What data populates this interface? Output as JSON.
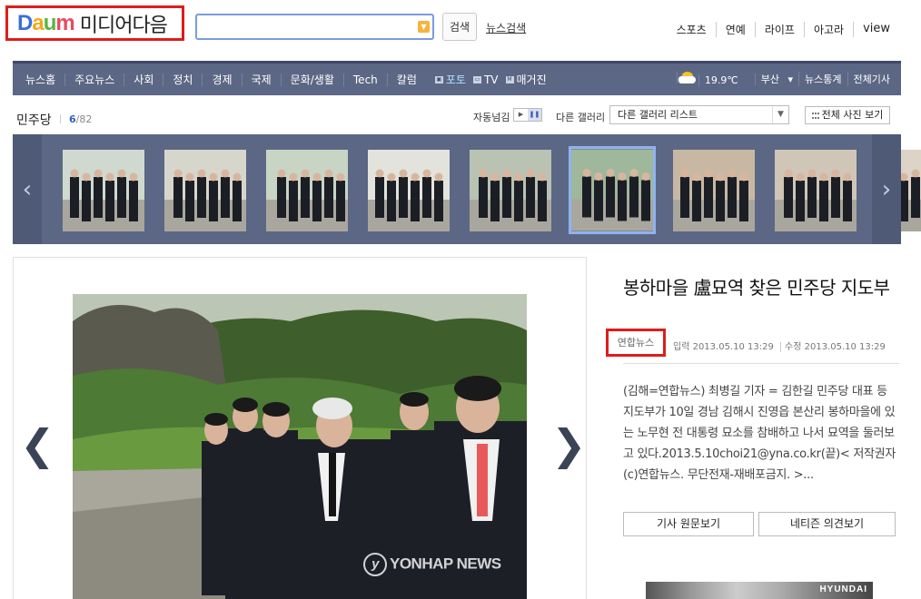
{
  "header": {
    "logo_daum": [
      "D",
      "a",
      "u",
      "m"
    ],
    "logo_text": "미디어다음",
    "search_placeholder": "",
    "search_button": "검색",
    "news_search": "뉴스검색",
    "top_links": [
      "스포츠",
      "연예",
      "라이프",
      "아고라",
      "view"
    ]
  },
  "nav": {
    "items": [
      "뉴스홈",
      "주요뉴스",
      "사회",
      "정치",
      "경제",
      "국제",
      "문화/생활",
      "Tech",
      "칼럼"
    ],
    "sub_items": [
      {
        "icon": "photo-icon",
        "label": "포토",
        "active": true
      },
      {
        "icon": "tv-icon",
        "label": "TV",
        "active": false
      },
      {
        "icon": "magazine-icon",
        "mark": "M",
        "label": "매거진",
        "active": false
      }
    ],
    "weather": "19.9℃",
    "region": "부산",
    "right_links": [
      "뉴스통계",
      "전체기사"
    ]
  },
  "gallery": {
    "title": "민주당",
    "current": "6",
    "total": "/82",
    "autoplay_label": "자동넘김",
    "other_gallery_label": "다른 갤러리",
    "select_value": "다른 갤러리 리스트",
    "all_view": "전체 사진 보기",
    "thumbnail_count": 9,
    "selected_index": 5
  },
  "article": {
    "title": "봉하마을 盧묘역 찾은 민주당 지도부",
    "source": "연합뉴스",
    "input_time": "입력 2013.05.10 13:29",
    "edit_time": "수정 2013.05.10 13:29",
    "body": "(김해=연합뉴스) 최병길 기자 = 김한길 민주당 대표 등 지도부가 10일 경남 김해시 진영읍 본산리 봉하마을에 있는 노무현 전 대통령 묘소를 참배하고 나서 묘역을 둘러보고 있다.2013.5.10choi21@yna.co.kr(끝)< 저작권자(c)연합뉴스. 무단전재-재배포금지. >...",
    "button_original": "기사 원문보기",
    "button_opinion": "네티즌 의견보기"
  },
  "photo": {
    "watermark_mark": "y",
    "watermark": "YONHAP NEWS"
  },
  "ad": {
    "brand": "HYUNDAI"
  },
  "colors": {
    "nav_bg": "#5b6784",
    "accent_blue": "#2f5fc2",
    "highlight_red": "#e01c1c"
  }
}
